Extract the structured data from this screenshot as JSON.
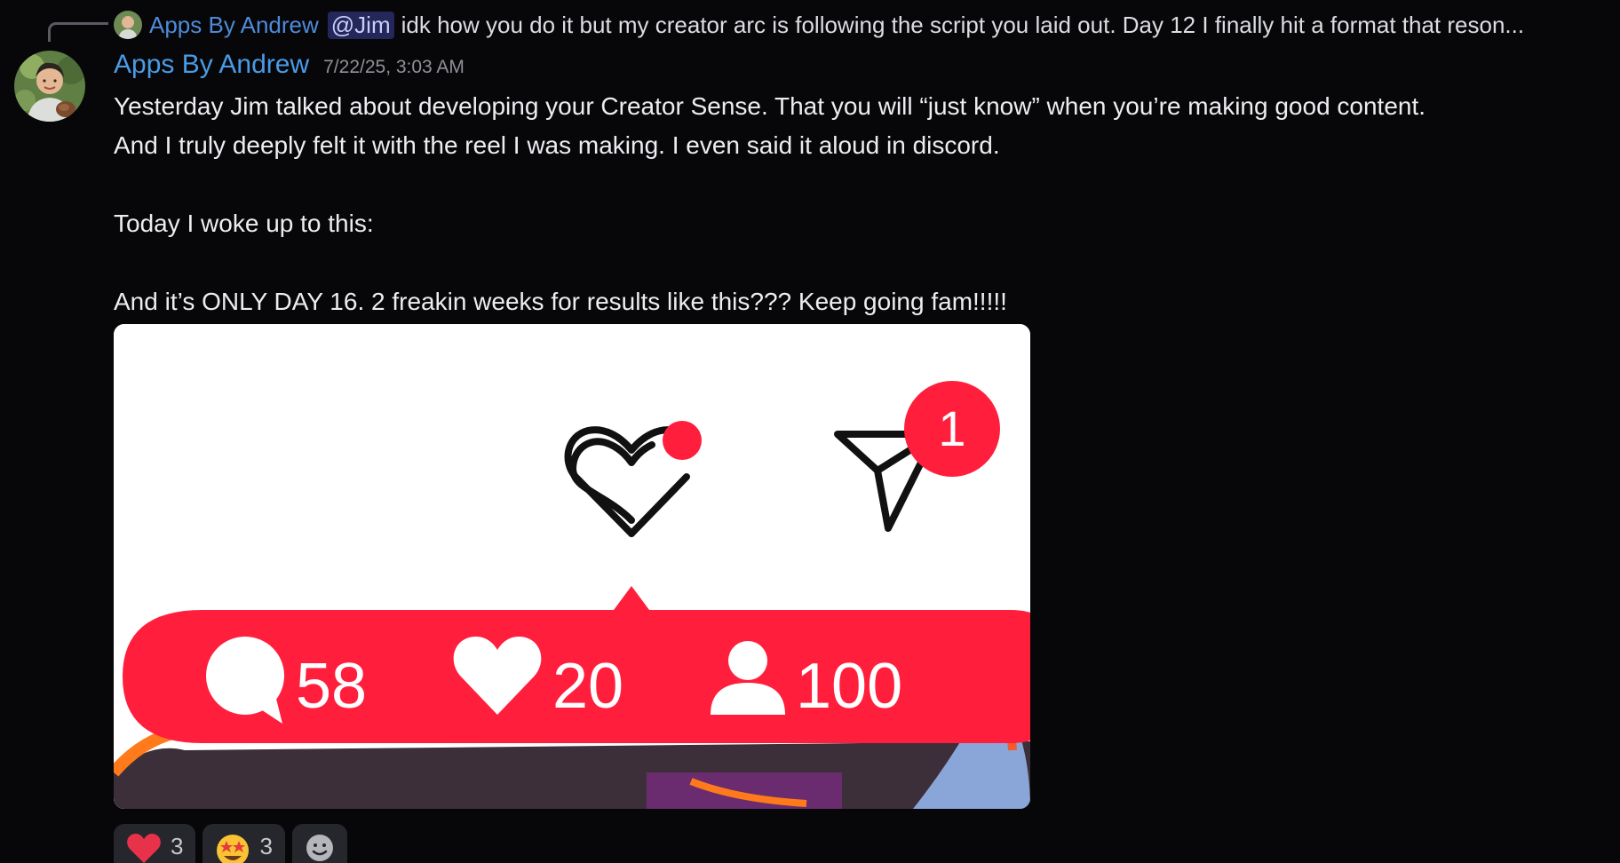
{
  "reply": {
    "author": "Apps By Andrew",
    "mention": "@Jim",
    "text": "idk how you do it but my creator arc is following the script you laid out. Day 12 I finally hit a format that reson..."
  },
  "message": {
    "author": "Apps By Andrew",
    "timestamp": "7/22/25, 3:03 AM",
    "lines": [
      "Yesterday Jim talked about developing your Creator Sense. That you will “just know” when you’re making good content.",
      "And I truly deeply felt it with the reel I was making. I even said it aloud in discord.",
      "",
      "Today I woke up to this:",
      "",
      "And it’s ONLY DAY 16. 2 freakin weeks for results like this??? Keep going fam!!!!!"
    ]
  },
  "attachment": {
    "badge_count": "1",
    "comments": "58",
    "likes": "20",
    "followers": "100",
    "colors": {
      "notification_red": "#ff1f3d",
      "background": "#ffffff"
    }
  },
  "reactions": [
    {
      "emoji": "heart-emoji",
      "count": "3"
    },
    {
      "emoji": "star-struck-emoji",
      "count": "3"
    },
    {
      "emoji": "add-reaction-icon",
      "count": ""
    }
  ],
  "colors": {
    "background": "#070709",
    "author": "#4a9be6",
    "timestamp": "#8f9198",
    "reaction_bg": "#26272d"
  }
}
